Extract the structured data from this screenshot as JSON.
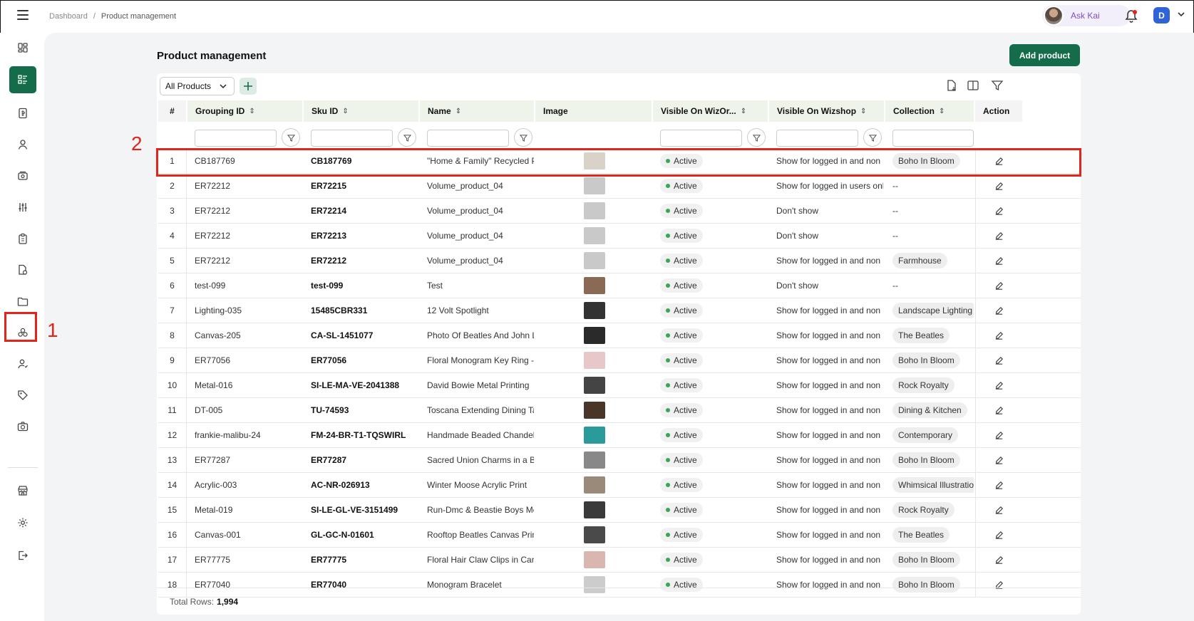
{
  "breadcrumb": {
    "root": "Dashboard",
    "sep": "/",
    "current": "Product management"
  },
  "header": {
    "ask_kai": "Ask Kai",
    "user_initial": "D"
  },
  "page": {
    "title": "Product management",
    "add_button": "Add product",
    "view_select": "All Products"
  },
  "columns": [
    "#",
    "Grouping ID",
    "Sku ID",
    "Name",
    "Image",
    "Visible On WizOr...",
    "Visible On Wizshop",
    "Collection",
    "Action"
  ],
  "rows": [
    {
      "n": "1",
      "group": "CB187769",
      "sku": "CB187769",
      "name": "\"Home & Family\" Recycled Pa",
      "status": "Active",
      "wizshop": "Show for logged in and non lo",
      "collection": "Boho In Bloom",
      "thumb": "#d9d2c8"
    },
    {
      "n": "2",
      "group": "ER72212",
      "sku": "ER72215",
      "name": "Volume_product_04",
      "status": "Active",
      "wizshop": "Show for logged in users only",
      "collection": "--",
      "thumb": "#c9c9c9"
    },
    {
      "n": "3",
      "group": "ER72212",
      "sku": "ER72214",
      "name": "Volume_product_04",
      "status": "Active",
      "wizshop": "Don't show",
      "collection": "--",
      "thumb": "#c9c9c9"
    },
    {
      "n": "4",
      "group": "ER72212",
      "sku": "ER72213",
      "name": "Volume_product_04",
      "status": "Active",
      "wizshop": "Don't show",
      "collection": "--",
      "thumb": "#c9c9c9"
    },
    {
      "n": "5",
      "group": "ER72212",
      "sku": "ER72212",
      "name": "Volume_product_04",
      "status": "Active",
      "wizshop": "Show for logged in and non lo",
      "collection": "Farmhouse",
      "thumb": "#c9c9c9"
    },
    {
      "n": "6",
      "group": "test-099",
      "sku": "test-099",
      "name": "Test",
      "status": "Active",
      "wizshop": "Don't show",
      "collection": "--",
      "thumb": "#8b6a55"
    },
    {
      "n": "7",
      "group": "Lighting-035",
      "sku": "15485CBR331",
      "name": "12 Volt Spotlight",
      "status": "Active",
      "wizshop": "Show for logged in and non lo",
      "collection": "Landscape Lighting",
      "thumb": "#333333"
    },
    {
      "n": "8",
      "group": "Canvas-205",
      "sku": "CA-SL-1451077",
      "name": "Photo Of Beatles And John Le",
      "status": "Active",
      "wizshop": "Show for logged in and non lo",
      "collection": "The Beatles",
      "thumb": "#2a2a2a"
    },
    {
      "n": "9",
      "group": "ER77056",
      "sku": "ER77056",
      "name": "Floral Monogram Key Ring - F",
      "status": "Active",
      "wizshop": "Show for logged in and non lo",
      "collection": "Boho In Bloom",
      "thumb": "#e7c7c7"
    },
    {
      "n": "10",
      "group": "Metal-016",
      "sku": "SI-LE-MA-VE-2041388",
      "name": "David Bowie Metal Printing",
      "status": "Active",
      "wizshop": "Show for logged in and non lo",
      "collection": "Rock Royalty",
      "thumb": "#444444"
    },
    {
      "n": "11",
      "group": "DT-005",
      "sku": "TU-74593",
      "name": "Toscana Extending Dining Tal",
      "status": "Active",
      "wizshop": "Show for logged in and non lo",
      "collection": "Dining & Kitchen",
      "thumb": "#4a3628"
    },
    {
      "n": "12",
      "group": "frankie-malibu-24",
      "sku": "FM-24-BR-T1-TQSWIRL",
      "name": "Handmade Beaded Chandelie",
      "status": "Active",
      "wizshop": "Show for logged in and non lo",
      "collection": "Contemporary",
      "thumb": "#2a9a9a"
    },
    {
      "n": "13",
      "group": "ER77287",
      "sku": "ER77287",
      "name": "Sacred Union Charms in a Ba",
      "status": "Active",
      "wizshop": "Show for logged in and non lo",
      "collection": "Boho In Bloom",
      "thumb": "#888888"
    },
    {
      "n": "14",
      "group": "Acrylic-003",
      "sku": "AC-NR-026913",
      "name": "Winter Moose Acrylic Print",
      "status": "Active",
      "wizshop": "Show for logged in and non lo",
      "collection": "Whimsical Illustrations",
      "thumb": "#9a8a7a"
    },
    {
      "n": "15",
      "group": "Metal-019",
      "sku": "SI-LE-GL-VE-3151499",
      "name": "Run-Dmc & Beastie Boys Met",
      "status": "Active",
      "wizshop": "Show for logged in and non lo",
      "collection": "Rock Royalty",
      "thumb": "#3a3a3a"
    },
    {
      "n": "16",
      "group": "Canvas-001",
      "sku": "GL-GC-N-01601",
      "name": "Rooftop Beatles Canvas Print",
      "status": "Active",
      "wizshop": "Show for logged in and non lo",
      "collection": "The Beatles",
      "thumb": "#4a4a4a"
    },
    {
      "n": "17",
      "group": "ER77775",
      "sku": "ER77775",
      "name": "Floral Hair Claw Clips in Canis",
      "status": "Active",
      "wizshop": "Show for logged in and non lo",
      "collection": "Boho In Bloom",
      "thumb": "#d9b7b0"
    },
    {
      "n": "18",
      "group": "ER77040",
      "sku": "ER77040",
      "name": "Monogram Bracelet",
      "status": "Active",
      "wizshop": "Show for logged in and non lo",
      "collection": "Boho In Bloom",
      "thumb": "#cccccc"
    }
  ],
  "footer": {
    "label": "Total Rows:",
    "count": "1,994"
  },
  "annotations": {
    "one": "1",
    "two": "2"
  },
  "colors": {
    "brand": "#156c4b",
    "highlight": "#e1251b",
    "active_dot": "#3aa655"
  }
}
